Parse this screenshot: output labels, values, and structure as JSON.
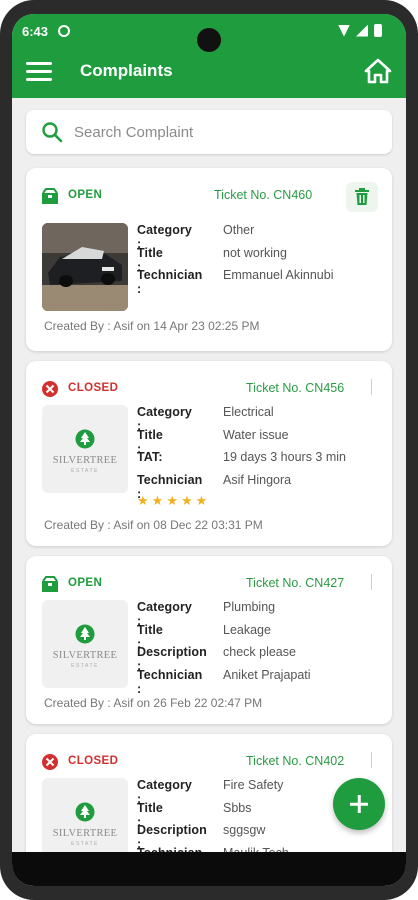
{
  "status_bar": {
    "time": "6:43"
  },
  "app_bar": {
    "title": "Complaints"
  },
  "search": {
    "placeholder": "Search Complaint"
  },
  "complaints": [
    {
      "status": "OPEN",
      "ticket": "Ticket No. CN460",
      "rows": [
        {
          "k": "Category :",
          "v": "Other"
        },
        {
          "k": "Title :",
          "v": "not working"
        },
        {
          "k": "Technician :",
          "v": "Emmanuel Akinnubi"
        }
      ],
      "created": "Created By : Asif on 14 Apr 23 02:25 PM"
    },
    {
      "status": "CLOSED",
      "ticket": "Ticket No. CN456",
      "rows": [
        {
          "k": "Category :",
          "v": "Electrical"
        },
        {
          "k": "Title :",
          "v": "Water issue"
        },
        {
          "k": "TAT:",
          "v": "19 days 3 hours 3 min"
        },
        {
          "k": "Technician :",
          "v": "Asif Hingora"
        }
      ],
      "rating": 5,
      "created": "Created By : Asif on 08 Dec 22 03:31 PM"
    },
    {
      "status": "OPEN",
      "ticket": "Ticket No. CN427",
      "rows": [
        {
          "k": "Category :",
          "v": "Plumbing"
        },
        {
          "k": "Title :",
          "v": "Leakage"
        },
        {
          "k": "Description :",
          "v": "check please"
        },
        {
          "k": "Technician :",
          "v": "Aniket Prajapati"
        }
      ],
      "created": "Created By : Asif on 26 Feb 22 02:47 PM"
    },
    {
      "status": "CLOSED",
      "ticket": "Ticket No. CN402",
      "rows": [
        {
          "k": "Category :",
          "v": "Fire Safety"
        },
        {
          "k": "Title :",
          "v": "Sbbs"
        },
        {
          "k": "Description :",
          "v": "sggsgw"
        },
        {
          "k": "Technician :",
          "v": "Maulik Tech"
        }
      ]
    }
  ],
  "logo": {
    "name": "SILVERTREE",
    "sub": "ESTATE"
  },
  "colors": {
    "primary": "#1f9d3e",
    "closed": "#d32f2f",
    "star": "#f2b01e"
  }
}
